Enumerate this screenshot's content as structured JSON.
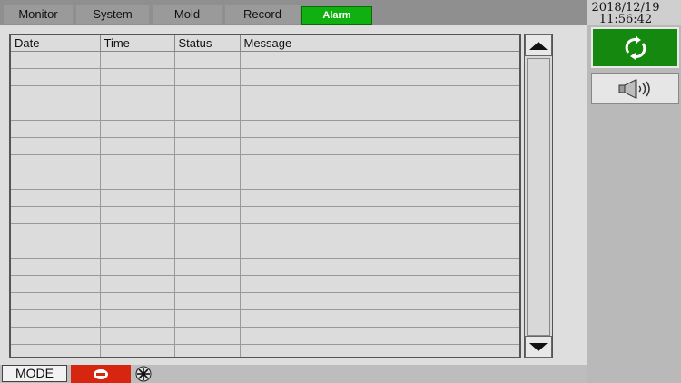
{
  "tabs": [
    {
      "label": "Monitor"
    },
    {
      "label": "System"
    },
    {
      "label": "Mold"
    },
    {
      "label": "Record"
    },
    {
      "label": "Alarm"
    }
  ],
  "clock": {
    "date": "2018/12/19",
    "time": "11:56:42"
  },
  "table": {
    "columns": [
      "Date",
      "Time",
      "Status",
      "Message"
    ],
    "row_count": 20
  },
  "statusbar": {
    "mode_label": "MODE"
  },
  "icons": {
    "refresh": "refresh-icon",
    "sound": "speaker-icon",
    "stop": "stop-icon",
    "fan": "fan-icon"
  },
  "colors": {
    "active_tab": "#10b010",
    "refresh_button": "#14880f",
    "stop_button": "#d62610"
  }
}
